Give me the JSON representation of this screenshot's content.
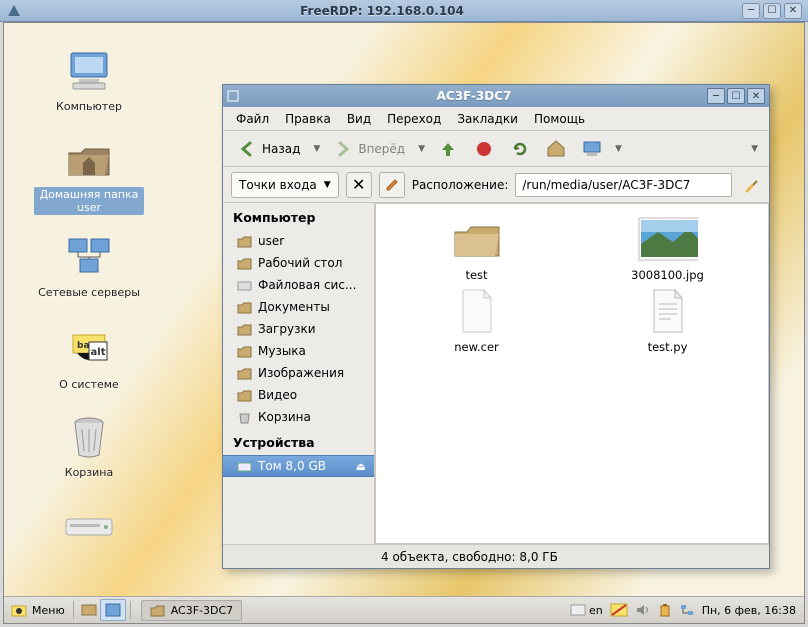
{
  "outer": {
    "title": "FreeRDP: 192.168.0.104"
  },
  "desktop_icons": [
    {
      "name": "computer",
      "label": "Компьютер"
    },
    {
      "name": "home",
      "label": "Домашняя папка user"
    },
    {
      "name": "network",
      "label": "Сетевые серверы"
    },
    {
      "name": "about",
      "label": "О системе"
    },
    {
      "name": "trash",
      "label": "Корзина"
    }
  ],
  "selected_desktop_icon": 1,
  "fm": {
    "title": "AC3F-3DC7",
    "menu": [
      "Файл",
      "Правка",
      "Вид",
      "Переход",
      "Закладки",
      "Помощь"
    ],
    "nav": {
      "back": "Назад",
      "forward": "Вперёд"
    },
    "entry_combo": "Точки входа",
    "location_label": "Расположение:",
    "location_value": "/run/media/user/AC3F-3DC7",
    "sidebar": {
      "head1": "Компьютер",
      "items": [
        "user",
        "Рабочий стол",
        "Файловая сис...",
        "Документы",
        "Загрузки",
        "Музыка",
        "Изображения",
        "Видео",
        "Корзина"
      ],
      "head2": "Устройства",
      "device": "Том 8,0 GB"
    },
    "files": [
      {
        "name": "test",
        "kind": "folder"
      },
      {
        "name": "3008100.jpg",
        "kind": "image"
      },
      {
        "name": "new.cer",
        "kind": "file"
      },
      {
        "name": "test.py",
        "kind": "text"
      }
    ],
    "status": "4 объекта, свободно: 8,0 ГБ"
  },
  "taskbar": {
    "menu": "Меню",
    "window": "AC3F-3DC7",
    "lang": "en",
    "clock": "Пн,  6 фев, 16:38"
  }
}
